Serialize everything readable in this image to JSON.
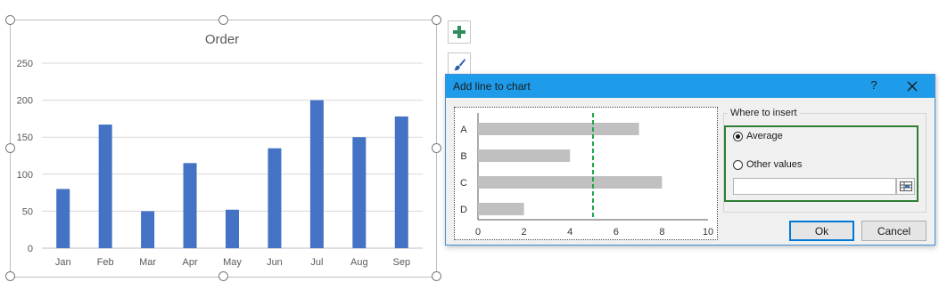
{
  "chart_data": [
    {
      "type": "bar",
      "title": "Order",
      "categories": [
        "Jan",
        "Feb",
        "Mar",
        "Apr",
        "May",
        "Jun",
        "Jul",
        "Aug",
        "Sep"
      ],
      "values": [
        80,
        167,
        50,
        115,
        52,
        135,
        200,
        150,
        178
      ],
      "ylim": [
        0,
        250
      ],
      "yticks": [
        "0",
        "50",
        "100",
        "150",
        "200",
        "250"
      ],
      "grid": true,
      "color": "#4472c4"
    },
    {
      "type": "bar",
      "orientation": "horizontal",
      "categories": [
        "A",
        "B",
        "C",
        "D"
      ],
      "values": [
        7,
        4,
        8,
        2
      ],
      "xlim": [
        0,
        10
      ],
      "xticks": [
        "0",
        "2",
        "4",
        "6",
        "8",
        "10"
      ],
      "reference_line": 5,
      "bar_color": "#c0c0c0",
      "line_color": "#1fa547"
    }
  ],
  "side_buttons": {
    "add_icon": "plus-icon",
    "style_icon": "paintbrush-icon"
  },
  "dialog": {
    "title": "Add line to chart",
    "help": "?",
    "close_icon": "close-icon",
    "group_label": "Where to insert",
    "option_average": "Average",
    "option_other": "Other values",
    "selected_option": "Average",
    "other_value": "",
    "range_icon": "range-select-icon",
    "ok_label": "Ok",
    "cancel_label": "Cancel"
  },
  "colors": {
    "title_bar": "#1e9be9",
    "highlight": "#2e7d32"
  }
}
